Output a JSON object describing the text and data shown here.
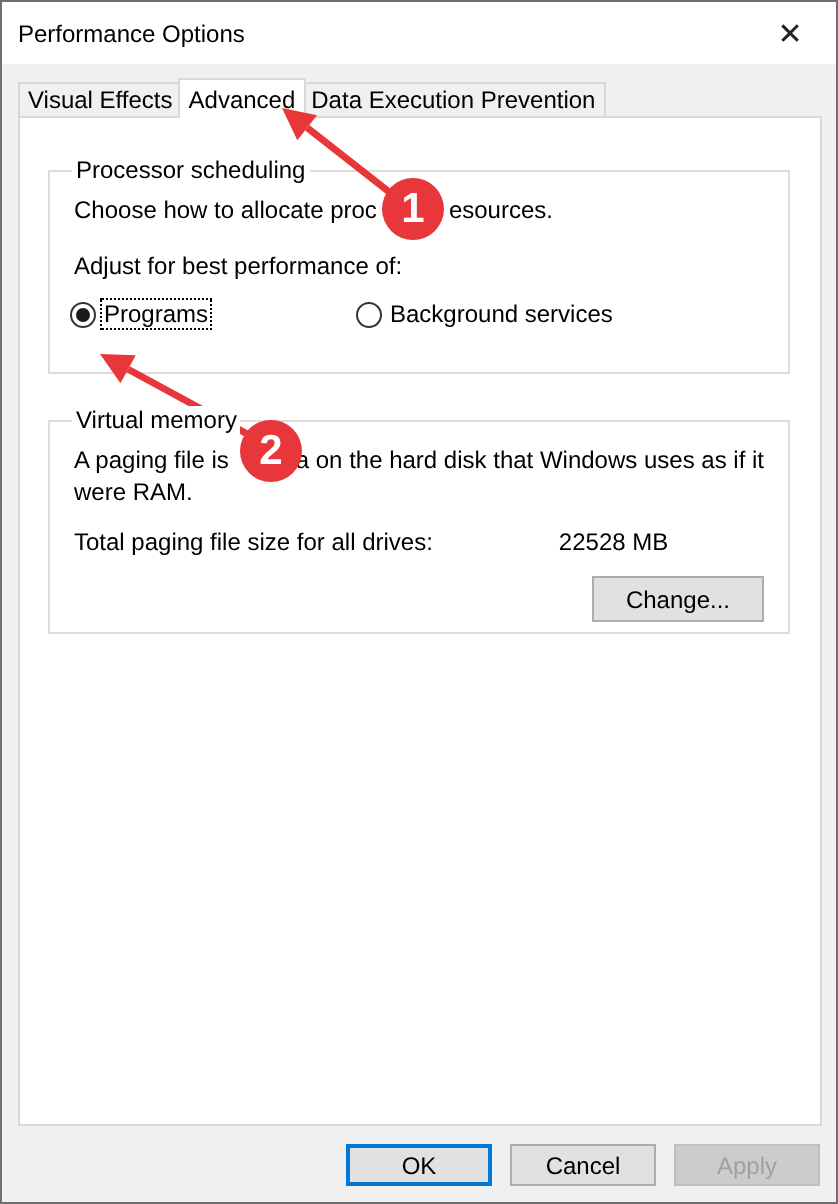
{
  "window": {
    "title": "Performance Options",
    "close": "✕"
  },
  "tabs": [
    {
      "label": "Visual Effects",
      "selected": false
    },
    {
      "label": "Advanced",
      "selected": true
    },
    {
      "label": "Data Execution Prevention",
      "selected": false
    }
  ],
  "processor_scheduling": {
    "legend": "Processor scheduling",
    "description_parts": [
      "Choose how to allocate proc",
      "esources."
    ],
    "prompt": "Adjust for best performance of:",
    "options": [
      {
        "label": "Programs",
        "selected": true,
        "focused": true
      },
      {
        "label": "Background services",
        "selected": false,
        "focused": false
      }
    ]
  },
  "virtual_memory": {
    "legend": "Virtual memory",
    "description_parts": [
      "A paging file is",
      "a on the hard disk that Windows uses as if it"
    ],
    "description_line_2": "were RAM.",
    "total_label": "Total paging file size for all drives:",
    "total_value": "22528 MB",
    "change_button": "Change..."
  },
  "buttons": [
    {
      "label": "OK",
      "default": true,
      "disabled": false
    },
    {
      "label": "Cancel",
      "default": false,
      "disabled": false
    },
    {
      "label": "Apply",
      "default": false,
      "disabled": true
    }
  ],
  "annotations": [
    {
      "number": "1"
    },
    {
      "number": "2"
    }
  ]
}
